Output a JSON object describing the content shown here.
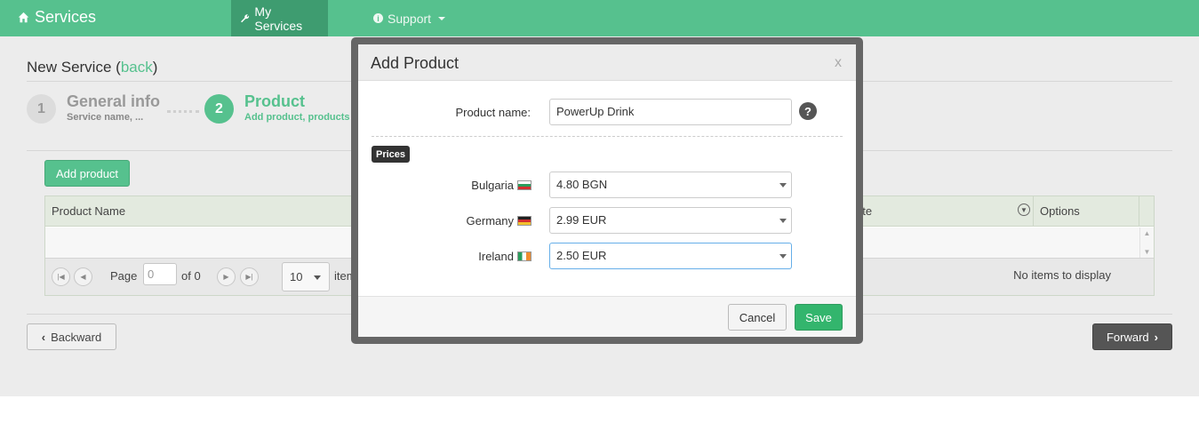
{
  "navbar": {
    "brand_icon": "home-icon",
    "brand": "Services",
    "items": [
      {
        "label": "My Services",
        "icon": "wrench-icon",
        "active": true
      },
      {
        "label": "Support",
        "icon": "info-icon",
        "dropdown": true
      }
    ]
  },
  "page": {
    "title": "New Service (",
    "back_link": "back",
    "title_end": ")"
  },
  "steps": [
    {
      "number": "1",
      "title": "General info",
      "subtitle": "Service name, ..."
    },
    {
      "number": "2",
      "title": "Product",
      "subtitle": "Add product, products"
    }
  ],
  "toolbar": {
    "add_product": "Add product"
  },
  "grid": {
    "columns": [
      "Product Name",
      "ate",
      "Options"
    ],
    "pager": {
      "page_label": "Page",
      "page_value": "0",
      "of_label": "of 0",
      "page_size": "10",
      "items_label": "items",
      "no_items": "No items to display"
    }
  },
  "nav_buttons": {
    "backward": "Backward",
    "forward": "Forward"
  },
  "modal": {
    "title": "Add Product",
    "close": "x",
    "product_name_label": "Product name:",
    "product_name_value": "PowerUp Drink",
    "help": "?",
    "prices_badge": "Prices",
    "prices": [
      {
        "country": "Bulgaria",
        "value": "4.80 BGN"
      },
      {
        "country": "Germany",
        "value": "2.99 EUR"
      },
      {
        "country": "Ireland",
        "value": "2.50 EUR"
      }
    ],
    "cancel": "Cancel",
    "save": "Save"
  },
  "colors": {
    "accent": "#56c18e",
    "nav_active": "#3e9c70",
    "save": "#33b56d",
    "overlay_frame": "#666666"
  }
}
